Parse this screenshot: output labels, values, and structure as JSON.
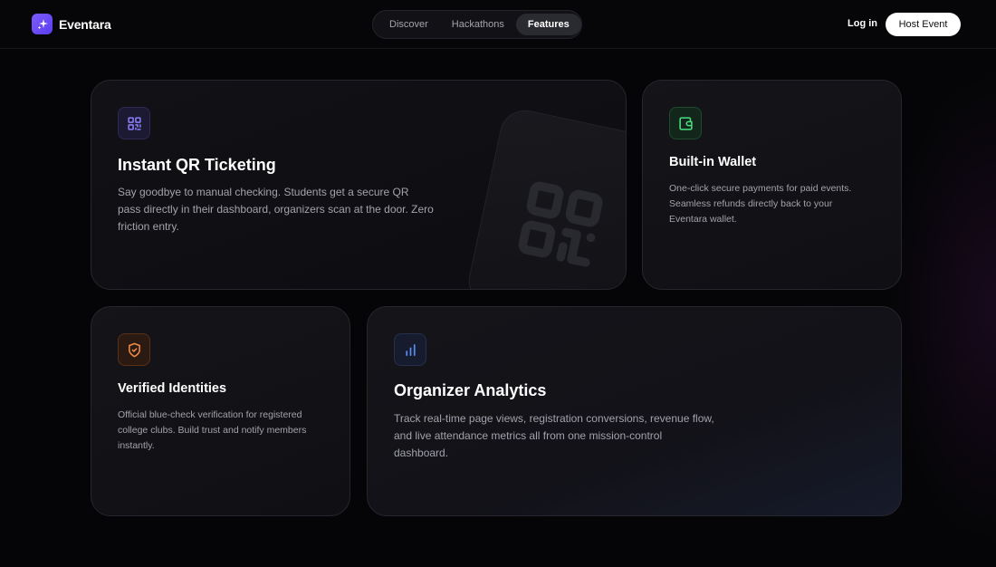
{
  "header": {
    "brand": "Eventara",
    "nav": [
      {
        "label": "Discover",
        "active": false
      },
      {
        "label": "Hackathons",
        "active": false
      },
      {
        "label": "Features",
        "active": true
      }
    ],
    "login_label": "Log in",
    "host_label": "Host Event"
  },
  "features": {
    "qr": {
      "icon": "qr-code-icon",
      "title": "Instant QR Ticketing",
      "description": "Say goodbye to manual checking. Students get a secure QR pass directly in their dashboard, organizers scan at the door. Zero friction entry."
    },
    "wallet": {
      "icon": "wallet-icon",
      "title": "Built-in Wallet",
      "description": "One-click secure payments for paid events. Seamless refunds directly back to your Eventara wallet."
    },
    "verified": {
      "icon": "shield-check-icon",
      "title": "Verified Identities",
      "description": "Official blue-check verification for registered college clubs. Build trust and notify members instantly."
    },
    "analytics": {
      "icon": "bar-chart-icon",
      "title": "Organizer Analytics",
      "description": "Track real-time page views, registration conversions, revenue flow, and live attendance metrics all from one mission-control dashboard."
    }
  },
  "colors": {
    "brand": "#6b4cf6",
    "qr_icon": "#8b7cf6",
    "wallet_icon": "#4ade80",
    "verified_icon": "#f08a45",
    "analytics_icon": "#5b8def"
  }
}
